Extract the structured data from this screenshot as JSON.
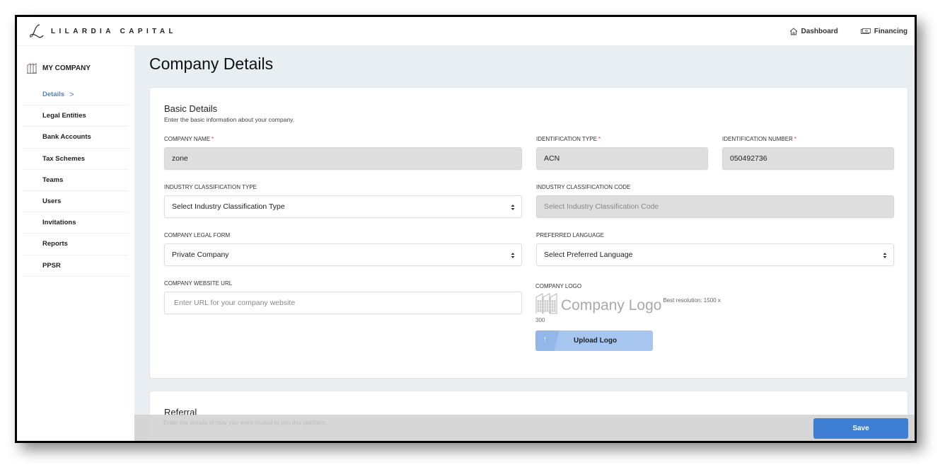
{
  "app": {
    "brand": "LILARDIA CAPITAL"
  },
  "topnav": {
    "items": [
      {
        "label": "Dashboard",
        "icon": "home-icon"
      },
      {
        "label": "Financing",
        "icon": "money-icon"
      }
    ]
  },
  "sidebar": {
    "header": "MY COMPANY",
    "header_icon": "building-icon",
    "items": [
      {
        "label": "Details",
        "active": true
      },
      {
        "label": "Legal Entities"
      },
      {
        "label": "Bank Accounts"
      },
      {
        "label": "Tax Schemes"
      },
      {
        "label": "Teams"
      },
      {
        "label": "Users"
      },
      {
        "label": "Invitations"
      },
      {
        "label": "Reports"
      },
      {
        "label": "PPSR"
      }
    ]
  },
  "page": {
    "title": "Company Details"
  },
  "basic": {
    "title": "Basic Details",
    "subtitle": "Enter the basic information about your company.",
    "company_name": {
      "label": "COMPANY NAME",
      "required": "*",
      "value": "zone"
    },
    "identification_type": {
      "label": "IDENTIFICATION TYPE",
      "required": "*",
      "value": "ACN"
    },
    "identification_number": {
      "label": "IDENTIFICATION NUMBER",
      "required": "*",
      "value": "050492736"
    },
    "industry_type": {
      "label": "INDUSTRY CLASSIFICATION TYPE",
      "value": "Select Industry Classification Type"
    },
    "industry_code": {
      "label": "INDUSTRY CLASSIFICATION CODE",
      "value": "Select Industry Classification Code"
    },
    "legal_form": {
      "label": "COMPANY LEGAL FORM",
      "value": "Private Company"
    },
    "preferred_language": {
      "label": "PREFERRED LANGUAGE",
      "value": "Select Preferred Language"
    },
    "website": {
      "label": "COMPANY WEBSITE URL",
      "value": "",
      "placeholder": "Enter URL for your company website"
    },
    "logo": {
      "label": "COMPANY LOGO",
      "placeholder_text": "Company Logo",
      "hint_line1": "Best resolution: 1500 x",
      "hint_line2": "300",
      "upload_label": "Upload Logo",
      "upload_icon": "↑"
    }
  },
  "referral": {
    "title": "Referral",
    "subtitle": "Enter the details of how you were invited to join this platform."
  },
  "footer": {
    "save_label": "Save"
  },
  "colors": {
    "accent": "#3f7fd3",
    "active_link": "#4a7fd1",
    "required": "#e53935",
    "main_bg": "#e9eef2",
    "disabled_field": "#dedede",
    "upload_button": "#a6c6f0"
  }
}
